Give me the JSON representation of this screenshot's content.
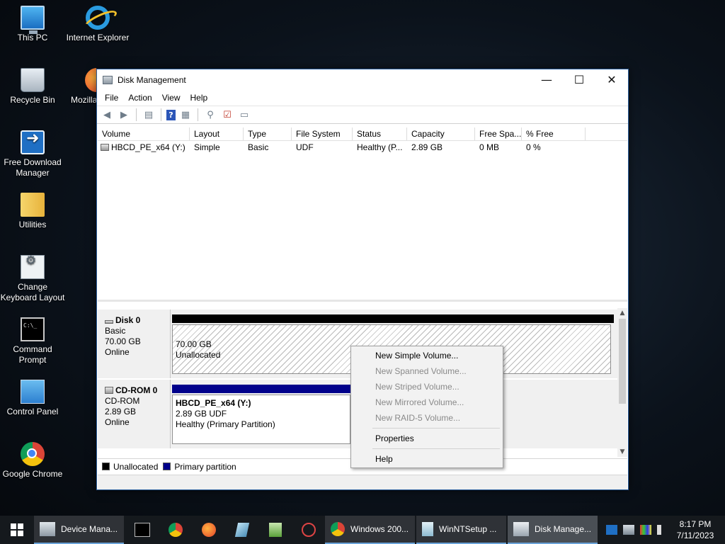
{
  "desktop": {
    "icons": [
      {
        "label": "This PC"
      },
      {
        "label": "Internet Explorer"
      },
      {
        "label": "Recycle Bin"
      },
      {
        "label": "Mozilla"
      },
      {
        "label": "Free Download Manager"
      },
      {
        "label": "Utilities"
      },
      {
        "label": "Change Keyboard Layout"
      },
      {
        "label": "Command Prompt"
      },
      {
        "label": "Control Panel"
      },
      {
        "label": "Google Chrome"
      }
    ]
  },
  "window": {
    "title": "Disk Management",
    "controls": {
      "minimize": "—",
      "maximize": "☐",
      "close": "✕"
    },
    "menu": [
      "File",
      "Action",
      "View",
      "Help"
    ]
  },
  "volume_list": {
    "columns": [
      "Volume",
      "Layout",
      "Type",
      "File System",
      "Status",
      "Capacity",
      "Free Spa...",
      "% Free"
    ],
    "rows": [
      {
        "volume": "HBCD_PE_x64 (Y:)",
        "layout": "Simple",
        "type": "Basic",
        "fs": "UDF",
        "status": "Healthy (P...",
        "capacity": "2.89 GB",
        "free": "0 MB",
        "pct": "0 %"
      }
    ]
  },
  "disks": [
    {
      "name": "Disk 0",
      "kind": "Basic",
      "size": "70.00 GB",
      "state": "Online",
      "partition": {
        "size": "70.00 GB",
        "label": "Unallocated"
      }
    },
    {
      "name": "CD-ROM 0",
      "kind": "CD-ROM",
      "size": "2.89 GB",
      "state": "Online",
      "partition": {
        "name": "HBCD_PE_x64  (Y:)",
        "fs": "2.89 GB UDF",
        "status": "Healthy (Primary Partition)"
      }
    }
  ],
  "legend": [
    {
      "label": "Unallocated",
      "color": "#000000"
    },
    {
      "label": "Primary partition",
      "color": "#00008b"
    }
  ],
  "context_menu": {
    "new_simple": "New Simple Volume...",
    "new_spanned": "New Spanned Volume...",
    "new_striped": "New Striped Volume...",
    "new_mirrored": "New Mirrored Volume...",
    "new_raid5": "New RAID-5 Volume...",
    "properties": "Properties",
    "help": "Help"
  },
  "taskbar": {
    "tasks": [
      {
        "label": "Device Mana..."
      },
      {
        "label": "Windows 200..."
      },
      {
        "label": "WinNTSetup ..."
      },
      {
        "label": "Disk Manage..."
      }
    ],
    "clock": {
      "time": "8:17 PM",
      "date": "7/11/2023"
    }
  },
  "colors": {
    "unallocated": "#000000",
    "primary": "#00008b",
    "accent": "#2b5f9e"
  }
}
